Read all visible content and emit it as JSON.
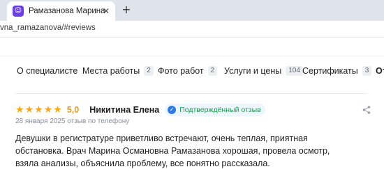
{
  "browser": {
    "tab_title": "Рамазанова Марина Османовна",
    "favicon_glyph": "☺",
    "close_glyph": "✕",
    "new_tab_glyph": "+",
    "url": "vna_ramazanova/#reviews"
  },
  "nav": {
    "items": [
      {
        "label": "О специалисте",
        "count": ""
      },
      {
        "label": "Места работы",
        "count": "2"
      },
      {
        "label": "Фото работ",
        "count": "2"
      },
      {
        "label": "Услуги и цены",
        "count": "104"
      },
      {
        "label": "Сертификаты",
        "count": "3"
      },
      {
        "label": "От",
        "count": ""
      }
    ]
  },
  "review": {
    "stars": [
      "★",
      "★",
      "★",
      "★",
      "★"
    ],
    "rating": "5,0",
    "author": "Никитина Елена",
    "verified_label": "Подтверждённый отзыв",
    "verified_glyph": "✓",
    "meta": "28 января 2025 отзыв по телефону",
    "text": "Девушки в регистратуре приветливо встречают, очень теплая, приятная обстановка. Врач Марина Османовна Рамазанова хорошая, провела осмотр, взяла анализы, объяснила проблему, все понятно рассказала."
  },
  "colors": {
    "star": "#f7a81b",
    "verified_text": "#1a9b4b",
    "verified_icon": "#2f7be5"
  }
}
